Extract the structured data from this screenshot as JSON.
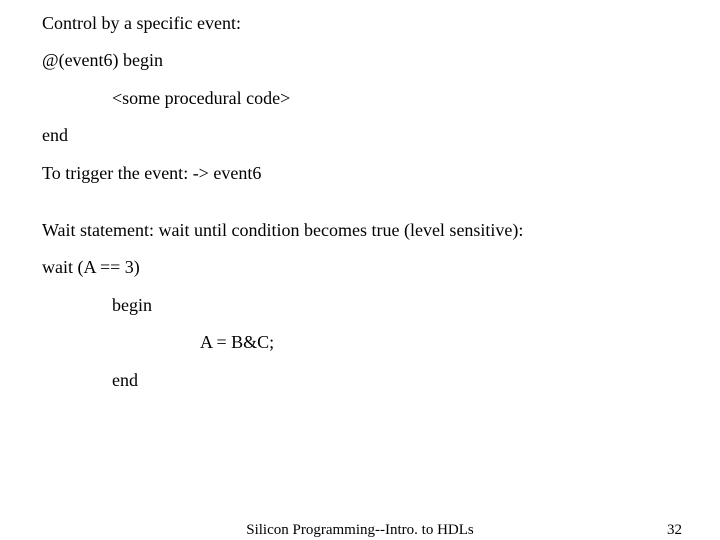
{
  "slide": {
    "line1": "Control by a specific event:",
    "line2": "@(event6) begin",
    "line3": "<some procedural code>",
    "line4": "end",
    "line5": "To trigger the event:   -> event6",
    "line6": "Wait statement:  wait until condition becomes true (level sensitive):",
    "line7": "wait (A == 3)",
    "line8": "begin",
    "line9": "A = B&C;",
    "line10": "end"
  },
  "footer": {
    "center": "Silicon Programming--Intro. to HDLs",
    "page": "32"
  }
}
